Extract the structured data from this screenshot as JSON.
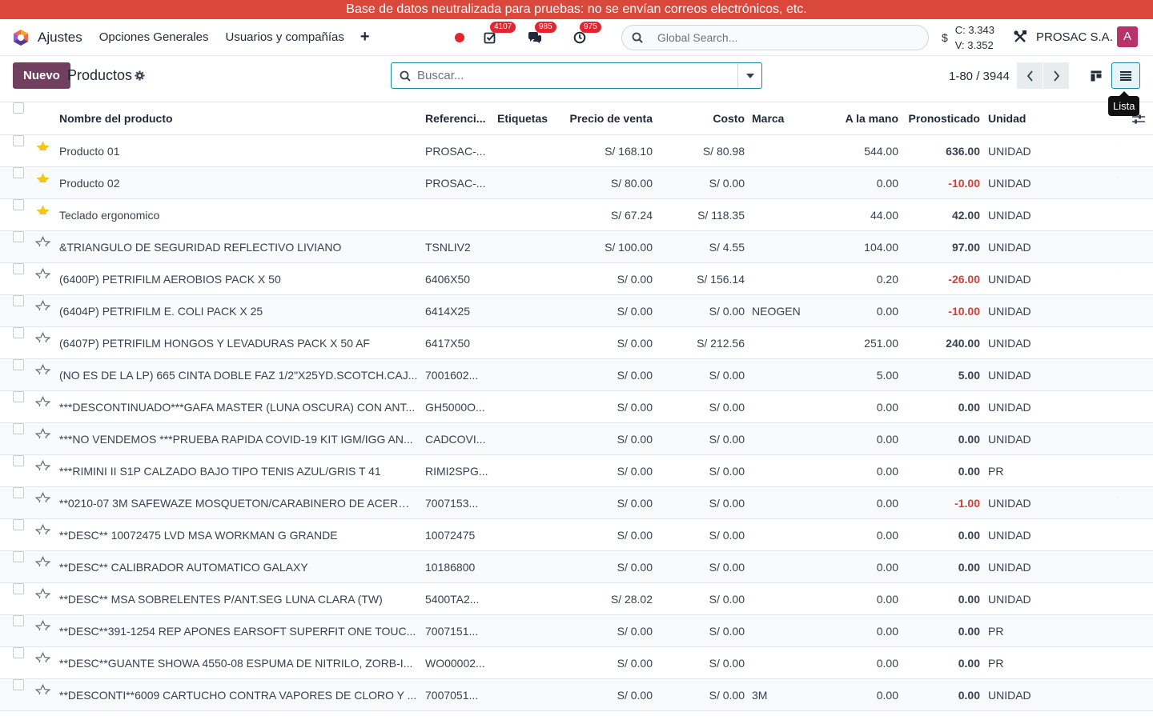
{
  "banner": {
    "text": "Base de datos neutralizada para pruebas: no se envían correos electrónicos, etc."
  },
  "navbar": {
    "app_name": "Ajustes",
    "menu": [
      "Opciones Generales",
      "Usuarios y compañías"
    ],
    "plus_label": "+",
    "badges": {
      "activities": "4107",
      "messages": "985",
      "timers": "975"
    },
    "global_search_placeholder": "Global Search...",
    "currency_symbol": "$",
    "currency_c": "C: 3.343",
    "currency_v": "V: 3.352",
    "company": "PROSAC S.A.",
    "avatar_letter": "A",
    "accent": "#71405f",
    "banner_color": "#d9483b"
  },
  "control": {
    "new_label": "Nuevo",
    "title": "Productos",
    "search_placeholder": "Buscar...",
    "pager": "1-80 / 3944",
    "tooltip": "Lista"
  },
  "table": {
    "headers": {
      "name": "Nombre del producto",
      "ref": "Referenci...",
      "tags": "Etiquetas",
      "price": "Precio de venta",
      "cost": "Costo",
      "brand": "Marca",
      "hand": "A la mano",
      "forecast": "Pronosticado",
      "unit": "Unidad"
    },
    "rows": [
      {
        "fav": true,
        "name": "Producto 01",
        "ref": "PROSAC-...",
        "price": "S/ 168.10",
        "cost": "S/ 80.98",
        "brand": "",
        "hand": "544.00",
        "forecast": "636.00",
        "neg": false,
        "unit": "UNIDAD",
        "warn": true
      },
      {
        "fav": true,
        "name": "Producto 02",
        "ref": "PROSAC-...",
        "price": "S/ 80.00",
        "cost": "S/ 0.00",
        "brand": "",
        "hand": "0.00",
        "forecast": "-10.00",
        "neg": true,
        "unit": "UNIDAD",
        "warn": true
      },
      {
        "fav": true,
        "name": "Teclado ergonomico",
        "ref": "",
        "price": "S/ 67.24",
        "cost": "S/ 118.35",
        "brand": "",
        "hand": "44.00",
        "forecast": "42.00",
        "neg": false,
        "unit": "UNIDAD",
        "warn": false
      },
      {
        "fav": false,
        "name": "&TRIANGULO DE SEGURIDAD REFLECTIVO LIVIANO",
        "ref": "TSNLIV2",
        "price": "S/ 100.00",
        "cost": "S/ 4.55",
        "brand": "",
        "hand": "104.00",
        "forecast": "97.00",
        "neg": false,
        "unit": "UNIDAD",
        "warn": false
      },
      {
        "fav": false,
        "name": "(6400P) PETRIFILM AEROBIOS PACK X 50",
        "ref": "6406X50",
        "price": "S/ 0.00",
        "cost": "S/ 156.14",
        "brand": "",
        "hand": "0.20",
        "forecast": "-26.00",
        "neg": true,
        "unit": "UNIDAD",
        "warn": true
      },
      {
        "fav": false,
        "name": "(6404P) PETRIFILM E. COLI PACK X 25",
        "ref": "6414X25",
        "price": "S/ 0.00",
        "cost": "S/ 0.00",
        "brand": "NEOGEN",
        "hand": "0.00",
        "forecast": "-10.00",
        "neg": true,
        "unit": "UNIDAD",
        "warn": false
      },
      {
        "fav": false,
        "name": "(6407P) PETRIFILM HONGOS Y LEVADURAS PACK X 50 AF",
        "ref": "6417X50",
        "price": "S/ 0.00",
        "cost": "S/ 212.56",
        "brand": "",
        "hand": "251.00",
        "forecast": "240.00",
        "neg": false,
        "unit": "UNIDAD",
        "warn": false
      },
      {
        "fav": false,
        "name": "(NO ES DE LA LP) 665 CINTA DOBLE FAZ 1/2\"X25YD.SCOTCH.CAJ...",
        "ref": "7001602...",
        "price": "S/ 0.00",
        "cost": "S/ 0.00",
        "brand": "",
        "hand": "5.00",
        "forecast": "5.00",
        "neg": false,
        "unit": "UNIDAD",
        "warn": false
      },
      {
        "fav": false,
        "name": "***DESCONTINUADO***GAFA MASTER (LUNA OSCURA) CON ANT...",
        "ref": "GH5000O...",
        "price": "S/ 0.00",
        "cost": "S/ 0.00",
        "brand": "",
        "hand": "0.00",
        "forecast": "0.00",
        "neg": false,
        "unit": "UNIDAD",
        "warn": false
      },
      {
        "fav": false,
        "name": "***NO VENDEMOS ***PRUEBA RAPIDA COVID-19 KIT IGM/IGG AN...",
        "ref": "CADCOVI...",
        "price": "S/ 0.00",
        "cost": "S/ 0.00",
        "brand": "",
        "hand": "0.00",
        "forecast": "0.00",
        "neg": false,
        "unit": "UNIDAD",
        "warn": false
      },
      {
        "fav": false,
        "name": "***RIMINI II S1P CALZADO BAJO TIPO TENIS AZUL/GRIS T 41",
        "ref": "RIMI2SPG...",
        "price": "S/ 0.00",
        "cost": "S/ 0.00",
        "brand": "",
        "hand": "0.00",
        "forecast": "0.00",
        "neg": false,
        "unit": "PR",
        "warn": false
      },
      {
        "fav": false,
        "name": "**0210-07 3M SAFEWAZE MOSQUETON/CARABINERO DE ACERO ...",
        "ref": "7007153...",
        "price": "S/ 0.00",
        "cost": "S/ 0.00",
        "brand": "",
        "hand": "0.00",
        "forecast": "-1.00",
        "neg": true,
        "unit": "UNIDAD",
        "warn": true
      },
      {
        "fav": false,
        "name": "**DESC** 10072475 LVD MSA WORKMAN G GRANDE",
        "ref": "10072475",
        "price": "S/ 0.00",
        "cost": "S/ 0.00",
        "brand": "",
        "hand": "0.00",
        "forecast": "0.00",
        "neg": false,
        "unit": "UNIDAD",
        "warn": false
      },
      {
        "fav": false,
        "name": "**DESC** CALIBRADOR AUTOMATICO GALAXY",
        "ref": "10186800",
        "price": "S/ 0.00",
        "cost": "S/ 0.00",
        "brand": "",
        "hand": "0.00",
        "forecast": "0.00",
        "neg": false,
        "unit": "UNIDAD",
        "warn": false
      },
      {
        "fav": false,
        "name": "**DESC** MSA SOBRELENTES P/ANT.SEG LUNA CLARA (TW)",
        "ref": "5400TA2...",
        "price": "S/ 28.02",
        "cost": "S/ 0.00",
        "brand": "",
        "hand": "0.00",
        "forecast": "0.00",
        "neg": false,
        "unit": "UNIDAD",
        "warn": false
      },
      {
        "fav": false,
        "name": "**DESC**391-1254 REP APONES EARSOFT SUPERFIT ONE TOUC...",
        "ref": "7007151...",
        "price": "S/ 0.00",
        "cost": "S/ 0.00",
        "brand": "",
        "hand": "0.00",
        "forecast": "0.00",
        "neg": false,
        "unit": "PR",
        "warn": false
      },
      {
        "fav": false,
        "name": "**DESC**GUANTE SHOWA 4550-08 ESPUMA DE NITRILO, ZORB-I...",
        "ref": "WO00002...",
        "price": "S/ 0.00",
        "cost": "S/ 0.00",
        "brand": "",
        "hand": "0.00",
        "forecast": "0.00",
        "neg": false,
        "unit": "PR",
        "warn": false
      },
      {
        "fav": false,
        "name": "**DESCONTI**6009 CARTUCHO CONTRA VAPORES DE CLORO Y ...",
        "ref": "7007051...",
        "price": "S/ 0.00",
        "cost": "S/ 0.00",
        "brand": "3M",
        "hand": "0.00",
        "forecast": "0.00",
        "neg": false,
        "unit": "UNIDAD",
        "warn": false
      }
    ]
  }
}
